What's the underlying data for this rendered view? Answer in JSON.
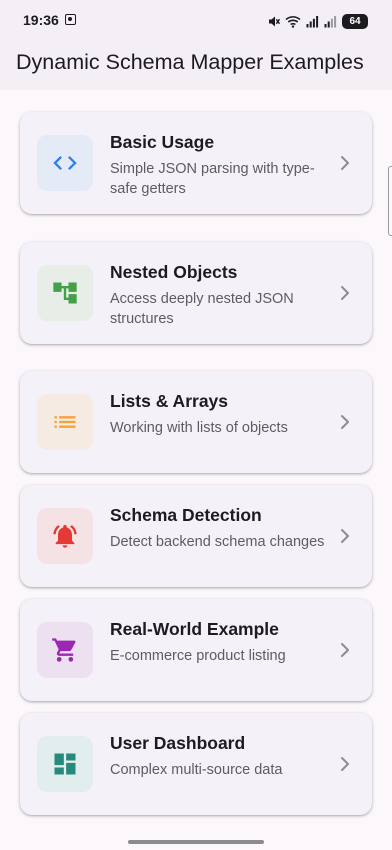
{
  "status_bar": {
    "time": "19:36",
    "battery": "64",
    "icons": [
      "screenshot-icon",
      "mute-icon",
      "wifi-icon",
      "signal-icon",
      "signal-icon",
      "battery-icon"
    ]
  },
  "app_bar": {
    "title": "Dynamic Schema Mapper Examples"
  },
  "colors": {
    "background": "#FCF7FB",
    "app_bar": "#F4EEF5",
    "card": "#F4F2F8",
    "title_text": "#1D1B20",
    "subtitle_text": "#5E5B63"
  },
  "examples": [
    {
      "title": "Basic Usage",
      "subtitle": "Simple JSON parsing with type-safe getters",
      "icon": "code-icon",
      "icon_color": "#2F80ED",
      "icon_bg": "#E4EAF6"
    },
    {
      "title": "Nested Objects",
      "subtitle": "Access deeply nested JSON structures",
      "icon": "account-tree-icon",
      "icon_color": "#43A047",
      "icon_bg": "#E6EEE7"
    },
    {
      "title": "Lists & Arrays",
      "subtitle": "Working with lists of objects",
      "icon": "list-icon",
      "icon_color": "#F5A23A",
      "icon_bg": "#F6EBE2"
    },
    {
      "title": "Schema Detection",
      "subtitle": "Detect backend schema changes",
      "icon": "notification-bell-icon",
      "icon_color": "#E53935",
      "icon_bg": "#F4E2E4"
    },
    {
      "title": "Real-World Example",
      "subtitle": "E-commerce product listing",
      "icon": "shopping-cart-icon",
      "icon_color": "#9C27B0",
      "icon_bg": "#EDE0F0"
    },
    {
      "title": "User Dashboard",
      "subtitle": "Complex multi-source data",
      "icon": "dashboard-icon",
      "icon_color": "#26897B",
      "icon_bg": "#E2EEEE"
    }
  ]
}
